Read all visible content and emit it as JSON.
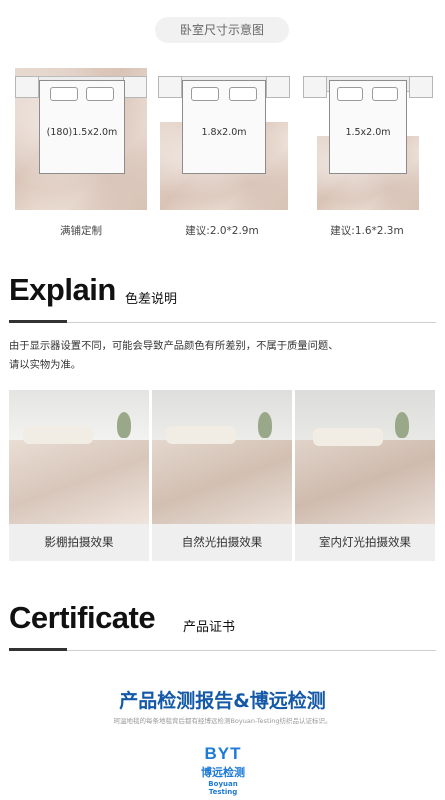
{
  "size_section": {
    "title": "卧室尺寸示意图",
    "diagrams": [
      {
        "bed_label": "(180)1.5x2.0m",
        "caption": "满铺定制"
      },
      {
        "bed_label": "1.8x2.0m",
        "caption": "建议:2.0*2.9m"
      },
      {
        "bed_label": "1.5x2.0m",
        "caption": "建议:1.6*2.3m"
      }
    ]
  },
  "explain": {
    "title": "Explain",
    "subtitle": "色差说明",
    "text_line1": "由于显示器设置不同，可能会导致产品颜色有所差别，不属于质量问题、",
    "text_line2": "请以实物为准。",
    "photos": [
      {
        "label": "影棚拍摄效果"
      },
      {
        "label": "自然光拍摄效果"
      },
      {
        "label": "室内灯光拍摄效果"
      }
    ]
  },
  "certificate": {
    "title": "Certificate",
    "subtitle": "产品证书",
    "report_title": "产品检测报告&博远检测",
    "report_note": "珂温地毯的每条地毯背后都有经博远检测Boyuan-Testing纺织品认证标识。",
    "logo_letters": "BYT",
    "logo_cn": "博远检测",
    "logo_en": "Boyuan Testing"
  },
  "colors": {
    "accent_blue": "#1458a8",
    "logo_blue": "#1d7ad6",
    "rug_beige": "#e2d1c6"
  }
}
